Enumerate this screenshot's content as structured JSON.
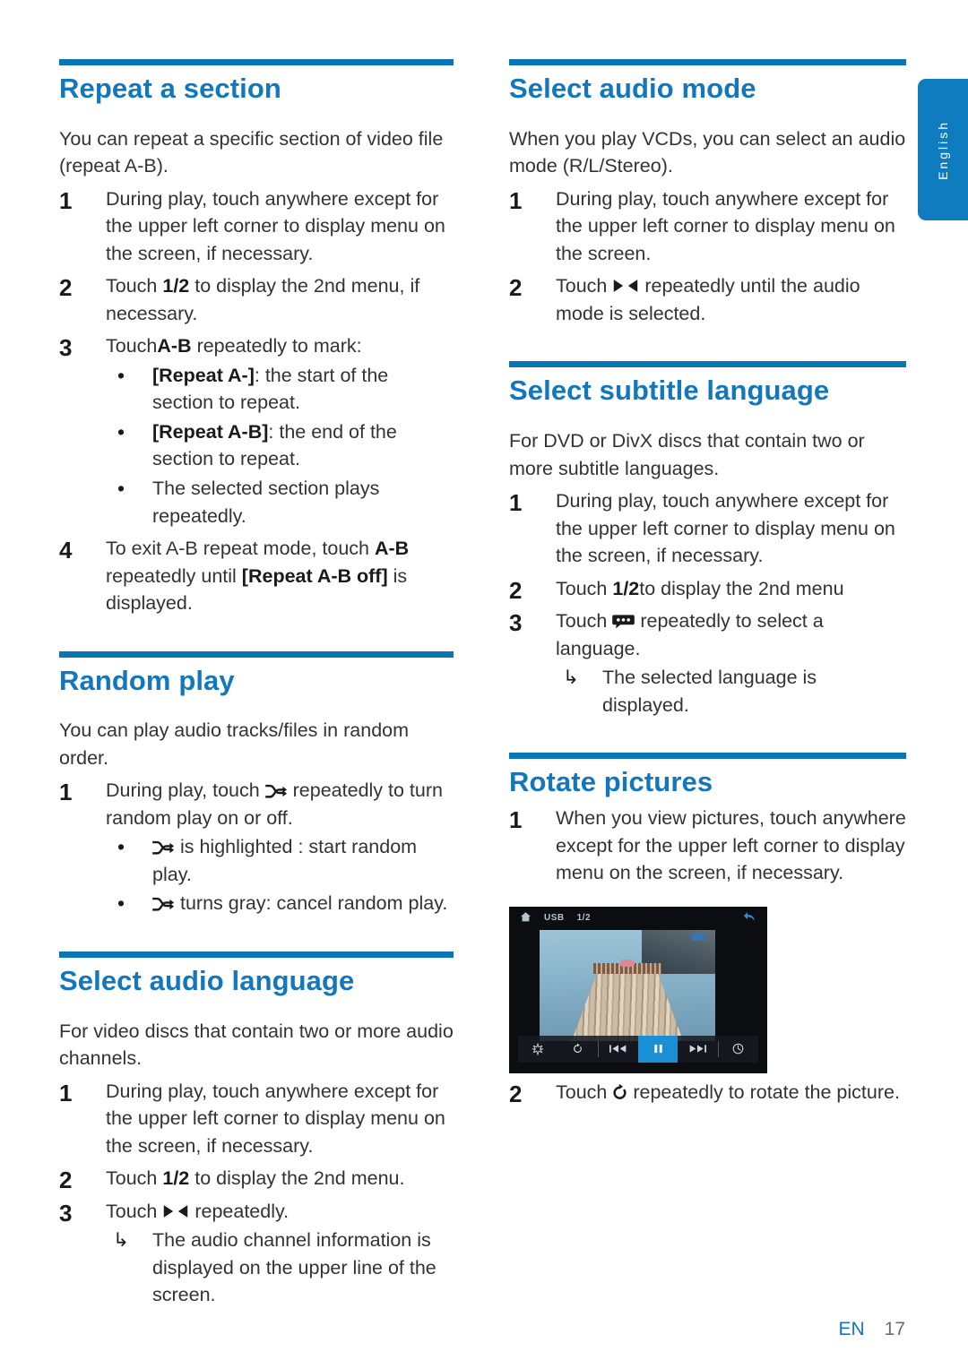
{
  "meta": {
    "accent_blue": "#1277bc",
    "rule_blue": "#0a76b6",
    "tab_blue": "#0f7cc0"
  },
  "side_tab": {
    "label": "English"
  },
  "footer": {
    "lang_code": "EN",
    "page_number": "17"
  },
  "left_column": {
    "sections": [
      {
        "heading": "Repeat a section",
        "intro": "You can repeat a specific section of video file (repeat A-B).",
        "steps": [
          {
            "num": "1",
            "text_html": "During play, touch anywhere except for the upper left corner to display menu on the screen, if necessary."
          },
          {
            "num": "2",
            "text_html": "Touch <b>1/2</b> to display the 2nd menu, if necessary."
          },
          {
            "num": "3",
            "text_html": "Touch<b>A-B</b> repeatedly to mark:",
            "sub": [
              {
                "mark": "•",
                "text_html": "<b>[Repeat A-]</b>: the start of the section to repeat."
              },
              {
                "mark": "•",
                "text_html": "<b>[Repeat A-B]</b>: the end of the section to repeat."
              },
              {
                "mark": "•",
                "text_html": "The selected section plays repeatedly."
              }
            ]
          },
          {
            "num": "4",
            "text_html": "To exit A-B repeat mode, touch <b>A-B</b> repeatedly until <b>[Repeat A-B off]</b> is displayed."
          }
        ]
      },
      {
        "heading": "Random play",
        "intro": "You can play audio tracks/files in random order.",
        "steps": [
          {
            "num": "1",
            "text_html": "During play, touch {{shuffle}} repeatedly to turn random play on or off.",
            "sub": [
              {
                "mark": "•",
                "text_html": "{{shuffle}} is highlighted : start random play."
              },
              {
                "mark": "•",
                "text_html": "{{shuffle}} turns gray: cancel random play."
              }
            ]
          }
        ]
      },
      {
        "heading": "Select audio language",
        "intro": "For video discs that contain two or more audio channels.",
        "steps": [
          {
            "num": "1",
            "text_html": "During play, touch anywhere except for the upper left corner to display menu on the screen, if necessary."
          },
          {
            "num": "2",
            "text_html": "Touch <b>1/2</b> to display the 2nd menu."
          },
          {
            "num": "3",
            "text_html": "Touch {{audio}} repeatedly.",
            "sub": [
              {
                "mark": "↳",
                "text_html": "The audio channel information is displayed on the upper line of the screen."
              }
            ]
          }
        ]
      }
    ]
  },
  "right_column": {
    "sections": [
      {
        "heading": "Select audio mode",
        "intro": "When you play VCDs, you can select an audio mode (R/L/Stereo).",
        "steps": [
          {
            "num": "1",
            "text_html": "During play, touch anywhere except for the upper left corner to display menu on the screen."
          },
          {
            "num": "2",
            "text_html": "Touch {{audio}} repeatedly until the audio mode is selected."
          }
        ]
      },
      {
        "heading": "Select subtitle language",
        "intro": "For DVD or DivX discs that contain two or more subtitle languages.",
        "steps": [
          {
            "num": "1",
            "text_html": "During play, touch anywhere except for the upper left corner to display menu on the screen, if necessary."
          },
          {
            "num": "2",
            "text_html": "Touch <b>1/2</b>to display the 2nd menu"
          },
          {
            "num": "3",
            "text_html": "Touch {{subtitle}} repeatedly to select a language.",
            "sub": [
              {
                "mark": "↳",
                "text_html": "The selected language is displayed."
              }
            ]
          }
        ]
      },
      {
        "heading": "Rotate pictures",
        "intro": "",
        "steps": [
          {
            "num": "1",
            "text_html": "When you view pictures, touch anywhere except for the upper left corner to display menu on the screen, if necessary."
          }
        ],
        "device_screenshot": {
          "topbar": {
            "home_icon": "home-icon",
            "source_label": "USB",
            "page_indicator": "1/2",
            "back_icon": "back-arrow-icon"
          },
          "bottombar": {
            "buttons": [
              {
                "icon": "brightness-icon",
                "active": false
              },
              {
                "icon": "rotate-icon",
                "active": false
              },
              {
                "icon": "previous-icon",
                "active": false
              },
              {
                "icon": "pause-icon",
                "active": true
              },
              {
                "icon": "next-icon",
                "active": false
              },
              {
                "icon": "timer-icon",
                "active": false
              }
            ]
          }
        },
        "steps_after_image": [
          {
            "num": "2",
            "text_html": "Touch {{rotate}} repeatedly to rotate the picture."
          }
        ]
      }
    ]
  }
}
